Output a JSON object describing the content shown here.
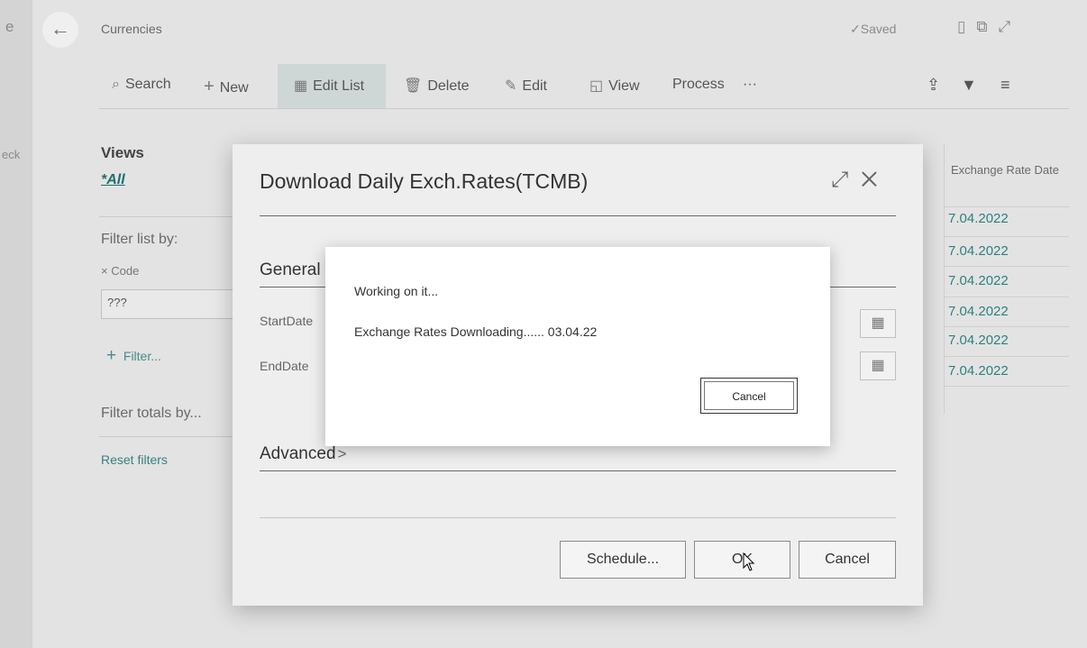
{
  "page": {
    "left_fragments": [
      "e",
      "eck"
    ],
    "back_icon": "back-arrow-icon",
    "breadcrumb": "Currencies",
    "saved_label": "✓Saved",
    "header_icons": [
      "bookmark-icon",
      "open-new-window-icon",
      "expand-icon"
    ]
  },
  "toolbar": {
    "search": "Search",
    "new": "New",
    "edit_list": "Edit List",
    "delete": "Delete",
    "edit": "Edit",
    "view": "View",
    "process": "Process",
    "more": "···",
    "right_icons": [
      "share-icon",
      "filter-icon",
      "list-view-icon"
    ]
  },
  "filter_pane": {
    "views_title": "Views",
    "views_all": "*All",
    "filter_list_by": "Filter list by:",
    "code_label": "Code",
    "code_value": "???",
    "add_filter": "Filter...",
    "filter_totals_by": "Filter totals by...",
    "reset_filters": "Reset filters"
  },
  "list": {
    "column_header": "Exchange Rate Date",
    "dates": [
      "7.04.2022",
      "7.04.2022",
      "7.04.2022",
      "7.04.2022",
      "7.04.2022",
      "7.04.2022"
    ]
  },
  "dialog": {
    "title": "Download Daily Exch.Rates(TCMB)",
    "general_section": "General",
    "start_date_label": "StartDate",
    "end_date_label": "EndDate",
    "advanced_section": "Advanced",
    "schedule_button": "Schedule...",
    "ok_button": "OK",
    "cancel_button": "Cancel"
  },
  "progress": {
    "title": "Working on it...",
    "message": "Exchange Rates Downloading...... 03.04.22",
    "cancel_button": "Cancel"
  }
}
